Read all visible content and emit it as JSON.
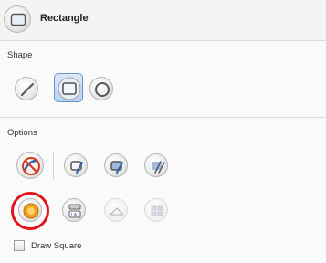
{
  "header": {
    "title": "Rectangle",
    "icon": "rectangle-tool-icon"
  },
  "shape": {
    "label": "Shape",
    "buttons": [
      {
        "name": "line-shape-icon",
        "selected": false
      },
      {
        "name": "rectangle-shape-icon",
        "selected": true
      },
      {
        "name": "ellipse-shape-icon",
        "selected": false
      }
    ]
  },
  "options": {
    "label": "Options",
    "row1": [
      "brush-off-icon",
      "stroke-mode-icon",
      "stroke-fill-mode-icon",
      "fill-mode-icon"
    ],
    "row2": [
      {
        "name": "auto-fill-icon",
        "highlighted": true,
        "enabled": true
      },
      {
        "name": "layer-options-icon",
        "enabled": true
      },
      {
        "name": "disabled-envelope-icon",
        "enabled": false
      },
      {
        "name": "disabled-grid-icon",
        "enabled": false
      }
    ],
    "checkbox": {
      "label": "Draw Square",
      "checked": false
    }
  },
  "colors": {
    "highlight": "#e3151a",
    "selected_bg": "#b9d3ef",
    "selected_border": "#6a94c8"
  }
}
